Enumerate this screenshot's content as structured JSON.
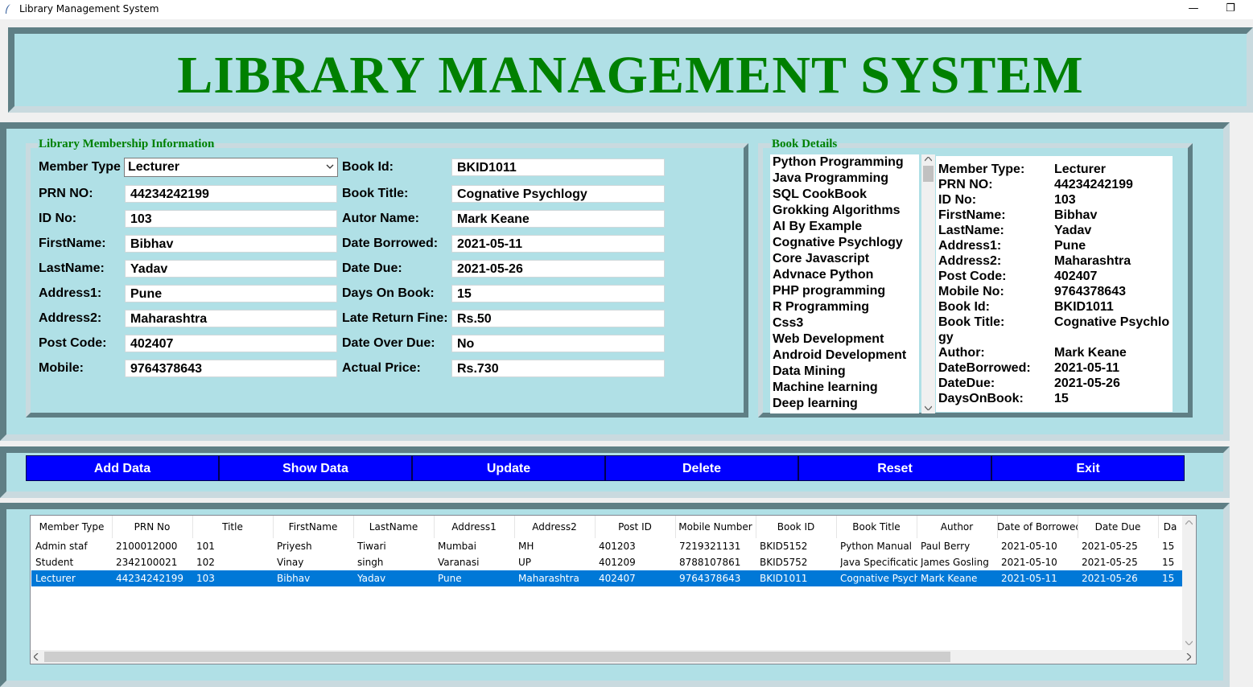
{
  "window": {
    "title": "Library Management System",
    "minimize": "—",
    "maximize": "❐"
  },
  "header": {
    "title": "LIBRARY MANAGEMENT SYSTEM"
  },
  "membership": {
    "legend": "Library Membership Information",
    "fields": [
      {
        "label": "Member Type",
        "value": "Lecturer"
      },
      {
        "label": "PRN NO:",
        "value": "44234242199"
      },
      {
        "label": "ID No:",
        "value": "103"
      },
      {
        "label": "FirstName:",
        "value": "Bibhav"
      },
      {
        "label": "LastName:",
        "value": "Yadav"
      },
      {
        "label": "Address1:",
        "value": "Pune"
      },
      {
        "label": "Address2:",
        "value": "Maharashtra"
      },
      {
        "label": "Post Code:",
        "value": "402407"
      },
      {
        "label": "Mobile:",
        "value": "9764378643"
      }
    ],
    "book_fields": [
      {
        "label": "Book Id:",
        "value": "BKID1011"
      },
      {
        "label": "Book Title:",
        "value": "Cognative Psychlogy"
      },
      {
        "label": "Autor Name:",
        "value": "Mark Keane"
      },
      {
        "label": "Date Borrowed:",
        "value": "2021-05-11"
      },
      {
        "label": "Date Due:",
        "value": "2021-05-26"
      },
      {
        "label": "Days On Book:",
        "value": "15"
      },
      {
        "label": "Late Return Fine:",
        "value": "Rs.50"
      },
      {
        "label": "Date Over Due:",
        "value": "No"
      },
      {
        "label": "Actual Price:",
        "value": "Rs.730"
      }
    ]
  },
  "book_details": {
    "legend": "Book Details",
    "books": [
      "Python Programming",
      "Java Programming",
      "SQL CookBook",
      "Grokking Algorithms",
      "AI By Example",
      "Cognative Psychlogy",
      "Core Javascript",
      "Advnace Python",
      "PHP programming",
      "R Programming",
      "Css3",
      "Web Development",
      "Android Development",
      "Data Mining",
      "Machine learning",
      "Deep learning"
    ],
    "details": [
      {
        "key": "Member Type:",
        "value": "Lecturer"
      },
      {
        "key": "PRN NO:",
        "value": "44234242199"
      },
      {
        "key": "ID No:",
        "value": "103"
      },
      {
        "key": "FirstName:",
        "value": "Bibhav"
      },
      {
        "key": "LastName:",
        "value": "Yadav"
      },
      {
        "key": "Address1:",
        "value": "Pune"
      },
      {
        "key": "Address2:",
        "value": "Maharashtra"
      },
      {
        "key": "Post Code:",
        "value": "402407"
      },
      {
        "key": "Mobile No:",
        "value": "9764378643"
      },
      {
        "key": "Book Id:",
        "value": "BKID1011"
      },
      {
        "key": "Book Title:",
        "value": "Cognative Psychlo"
      },
      {
        "key": "gy",
        "value": ""
      },
      {
        "key": "Author:",
        "value": "Mark Keane"
      },
      {
        "key": "DateBorrowed:",
        "value": "2021-05-11"
      },
      {
        "key": "DateDue:",
        "value": "2021-05-26"
      },
      {
        "key": "DaysOnBook:",
        "value": "15"
      }
    ]
  },
  "buttons": [
    "Add Data",
    "Show Data",
    "Update",
    "Delete",
    "Reset",
    "Exit"
  ],
  "colors": {
    "accent": "#b0e0e6",
    "title": "#008000",
    "button": "#0000ff",
    "selection": "#0078d7"
  },
  "table": {
    "headers": [
      "Member Type",
      "PRN No",
      "Title",
      "FirstName",
      "LastName",
      "Address1",
      "Address2",
      "Post ID",
      "Mobile Number",
      "Book ID",
      "Book Title",
      "Author",
      "Date of Borrowed",
      "Date Due",
      "Da"
    ],
    "rows": [
      [
        "Admin staf",
        "2100012000",
        "101",
        "Priyesh",
        "Tiwari",
        "Mumbai",
        "MH",
        "401203",
        "7219321131",
        "BKID5152",
        "Python Manual",
        "Paul Berry",
        "2021-05-10",
        "2021-05-25",
        "15"
      ],
      [
        "Student",
        "2342100021",
        "102",
        "Vinay",
        "singh",
        "Varanasi",
        "UP",
        "401209",
        "8788107861",
        "BKID5752",
        "Java Specification",
        "James Gosling",
        "2021-05-10",
        "2021-05-25",
        "15"
      ],
      [
        "Lecturer",
        "44234242199",
        "103",
        "Bibhav",
        "Yadav",
        "Pune",
        "Maharashtra",
        "402407",
        "9764378643",
        "BKID1011",
        "Cognative Psychl",
        "Mark Keane",
        "2021-05-11",
        "2021-05-26",
        "15"
      ]
    ],
    "selected_row": 2
  }
}
